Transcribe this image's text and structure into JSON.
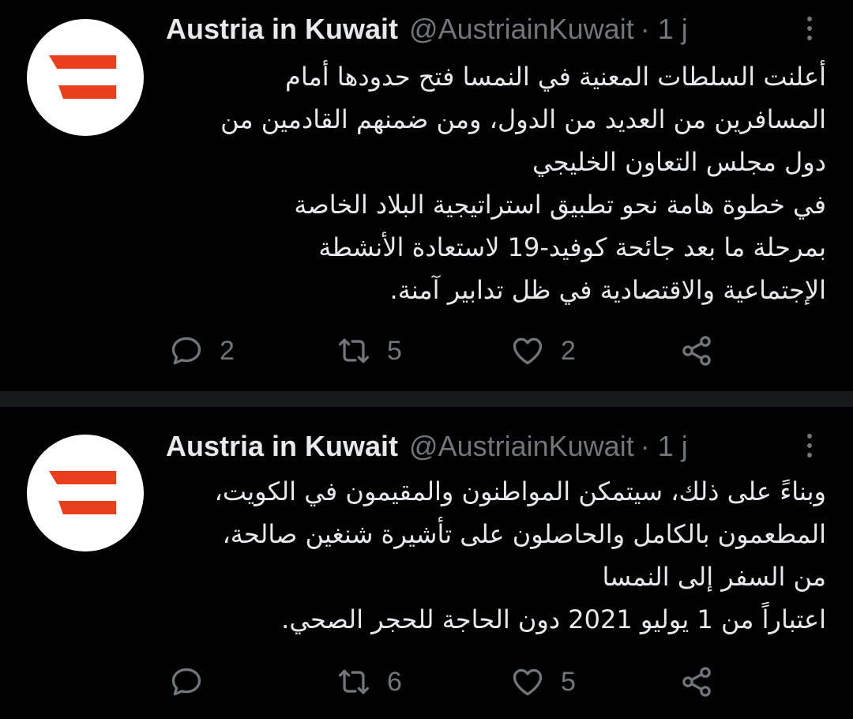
{
  "theme": {
    "background": "#000000",
    "divider": "#16181c",
    "text_primary": "#e7e9ea",
    "text_secondary": "#71767b",
    "flag_red": "#e8401c"
  },
  "tweets": [
    {
      "author": {
        "display_name": "Austria in Kuwait",
        "handle": "@AustriainKuwait",
        "avatar_icon": "austria-flag-logo"
      },
      "separator": "·",
      "time": "1 j",
      "text_lines": [
        "أعلنت السلطات المعنية في النمسا فتح حدودها أمام",
        "المسافرين من العديد من الدول، ومن ضمنهم القادمين من",
        "دول مجلس التعاون الخليجي",
        "في خطوة هامة نحو تطبيق استراتيجية البلاد الخاصة",
        "بمرحلة ما بعد جائحة كوفيد-19 لاستعادة الأنشطة",
        "الإجتماعية والاقتصادية في ظل تدابير آمنة."
      ],
      "actions": {
        "reply_count": "2",
        "retweet_count": "5",
        "like_count": "2",
        "reply_icon": "reply-icon",
        "retweet_icon": "retweet-icon",
        "like_icon": "heart-icon",
        "share_icon": "share-icon"
      }
    },
    {
      "author": {
        "display_name": "Austria in Kuwait",
        "handle": "@AustriainKuwait",
        "avatar_icon": "austria-flag-logo"
      },
      "separator": "·",
      "time": "1 j",
      "text_lines": [
        "وبناءً على ذلك، سيتمكن المواطنون والمقيمون في الكويت،",
        "المطعمون بالكامل والحاصلون على تأشيرة شنغين صالحة،",
        "من السفر إلى النمسا",
        "اعتباراً من 1 يوليو 2021 دون الحاجة للحجر الصحي."
      ],
      "actions": {
        "reply_count": "",
        "retweet_count": "6",
        "like_count": "5",
        "reply_icon": "reply-icon",
        "retweet_icon": "retweet-icon",
        "like_icon": "heart-icon",
        "share_icon": "share-icon"
      }
    }
  ]
}
